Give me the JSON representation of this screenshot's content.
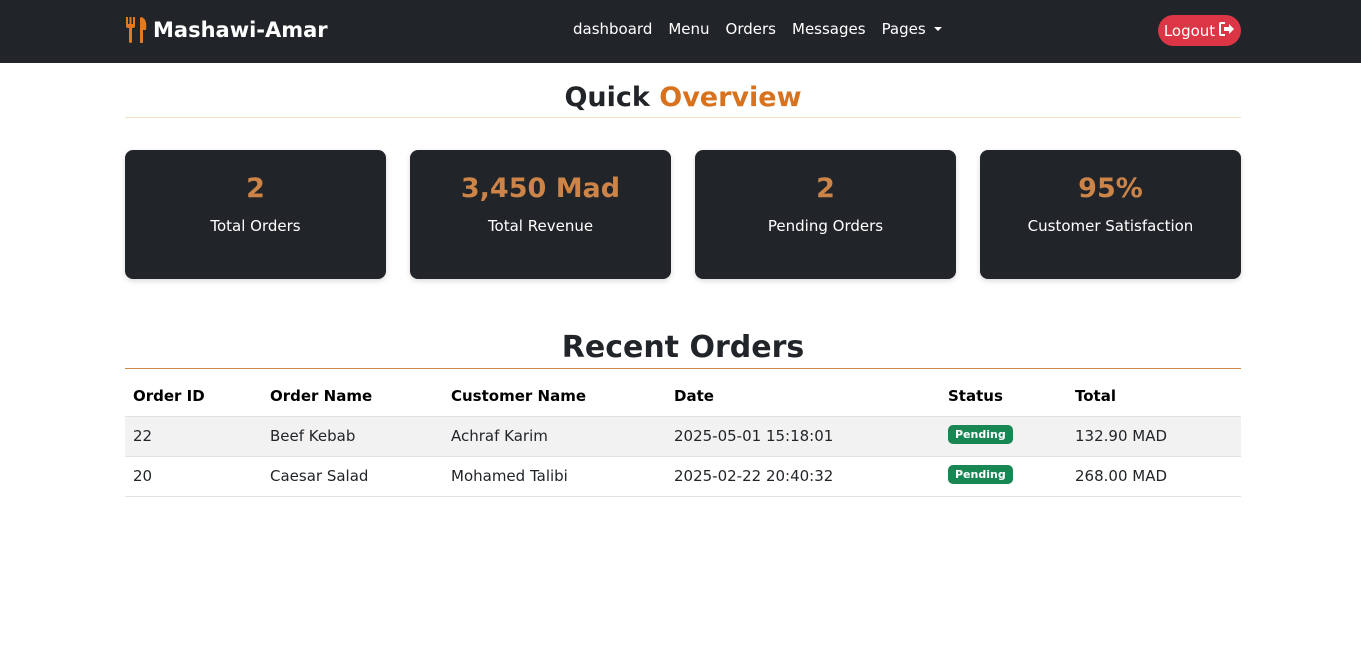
{
  "brand": {
    "name": "Mashawi-Amar",
    "icon": "utensils-icon",
    "icon_color": "#e07b22"
  },
  "nav": {
    "links": [
      "dashboard",
      "Menu",
      "Orders",
      "Messages",
      "Pages"
    ],
    "logout_label": "Logout",
    "logout_icon": "sign-out-icon"
  },
  "overview": {
    "title_part1": "Quick",
    "title_part2": "Overview",
    "accent_color": "#d9721e",
    "stats": [
      {
        "value": "2",
        "label": "Total Orders"
      },
      {
        "value": "3,450 Mad",
        "label": "Total Revenue"
      },
      {
        "value": "2",
        "label": "Pending Orders"
      },
      {
        "value": "95%",
        "label": "Customer Satisfaction"
      }
    ]
  },
  "recent_orders": {
    "title": "Recent Orders",
    "columns": [
      "Order ID",
      "Order Name",
      "Customer Name",
      "Date",
      "Status",
      "Total"
    ],
    "rows": [
      {
        "id": "22",
        "name": "Beef Kebab",
        "customer": "Achraf Karim",
        "date": "2025-05-01 15:18:01",
        "status": "Pending",
        "total": "132.90 MAD"
      },
      {
        "id": "20",
        "name": "Caesar Salad",
        "customer": "Mohamed Talibi",
        "date": "2025-02-22 20:40:32",
        "status": "Pending",
        "total": "268.00 MAD"
      }
    ]
  }
}
